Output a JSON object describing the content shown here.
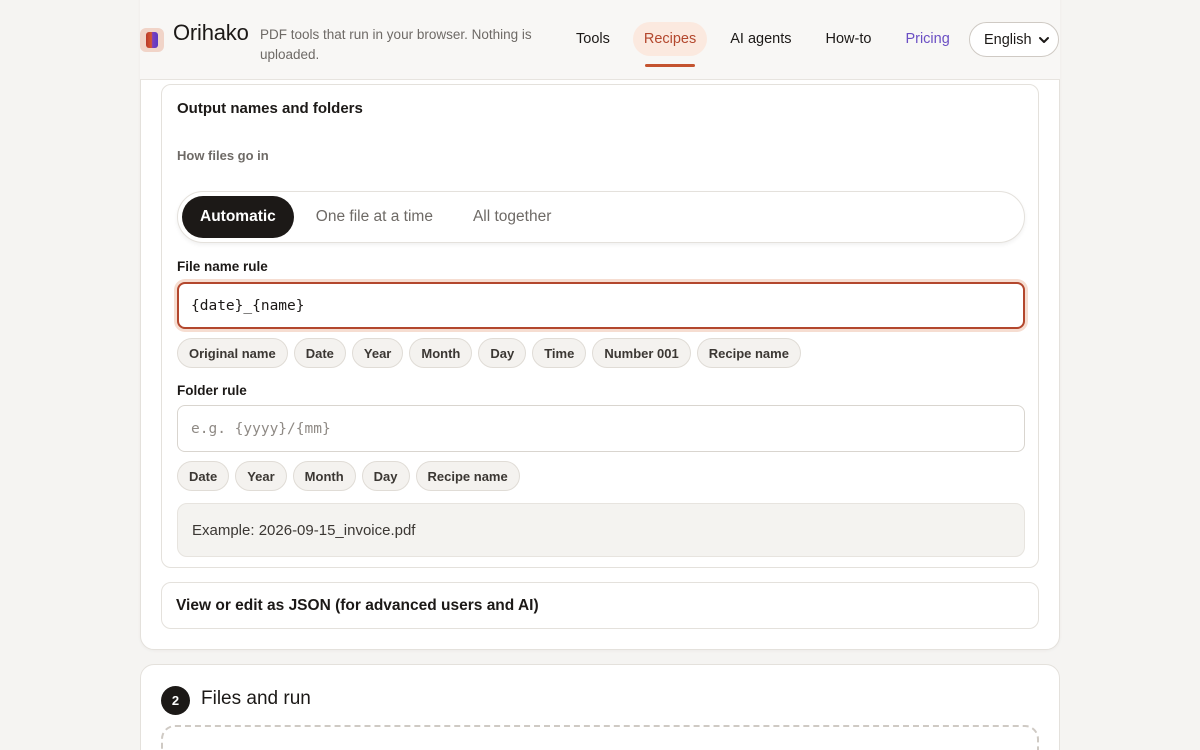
{
  "header": {
    "brand": "Orihako",
    "tagline": "PDF tools that run in your browser. Nothing is uploaded.",
    "nav": [
      {
        "label": "Tools"
      },
      {
        "label": "Recipes",
        "active": true
      },
      {
        "label": "AI agents"
      },
      {
        "label": "How-to"
      },
      {
        "label": "Pricing"
      }
    ],
    "language": "English"
  },
  "output_section": {
    "title": "Output names and folders",
    "mode_label": "How files go in",
    "modes": [
      "Automatic",
      "One file at a time",
      "All together"
    ],
    "selected_mode": "Automatic",
    "file_name_rule": {
      "label": "File name rule",
      "value": "{date}_{name}",
      "chips": [
        "Original name",
        "Date",
        "Year",
        "Month",
        "Day",
        "Time",
        "Number 001",
        "Recipe name"
      ]
    },
    "folder_rule": {
      "label": "Folder rule",
      "value": "",
      "placeholder": "e.g. {yyyy}/{mm}",
      "chips": [
        "Date",
        "Year",
        "Month",
        "Day",
        "Recipe name"
      ]
    },
    "example": "Example: 2026-09-15_invoice.pdf"
  },
  "json_toggle": "View or edit as JSON (for advanced users and AI)",
  "step2": {
    "number": "2",
    "title": "Files and run"
  },
  "colors": {
    "accent": "#b3472d",
    "accent_bg": "#fbe9df",
    "pricing": "#6b4fc4",
    "dark": "#1c1917"
  }
}
